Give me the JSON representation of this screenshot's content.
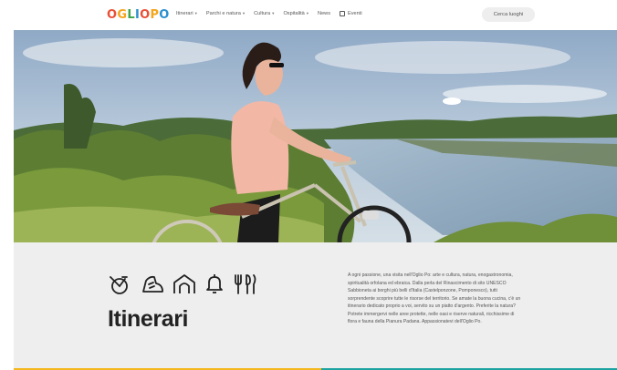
{
  "header": {
    "logo_letters": [
      {
        "ch": "O",
        "color": "#e94f35"
      },
      {
        "ch": "G",
        "color": "#f4a51c"
      },
      {
        "ch": "L",
        "color": "#3fa34d"
      },
      {
        "ch": "I",
        "color": "#2b8fcf"
      },
      {
        "ch": "O",
        "color": "#e94f35"
      },
      {
        "ch": "P",
        "color": "#f4a51c"
      },
      {
        "ch": "O",
        "color": "#2b8fcf"
      }
    ],
    "nav": {
      "itinerari": "Itinerari",
      "parchi": "Parchi e natura",
      "cultura": "Cultura",
      "ospitalita": "Ospitalità",
      "news": "News",
      "eventi": "Eventi"
    },
    "search_label": "Cerca luoghi"
  },
  "hero": {
    "alt": "Donna con bicicletta lungo il fiume Oglio"
  },
  "intro": {
    "title": "Itinerari",
    "icons": [
      "bicycle-icon",
      "hiking-boot-icon",
      "house-arch-icon",
      "bell-icon",
      "cutlery-icon"
    ],
    "text": "A ogni passione, una visita nell'Oglio Po: arte e cultura, natura, enogastronomia, spiritualità orfolana ed ebraica. Dalla perla del Rinascimento di sito UNESCO Sabbioneta ai borghi più belli d'Italia (Castelponzone, Pomponesco), tutti sorprendente scoprire tutte le risorse del territorio. Se amate la buona cucina, c'è un itinerario dedicato proprio a voi, servito su un piatto d'argento. Preferite la natura? Potrete immergervi nelle aree protette, nelle oasi e riserve naturali, ricchissime di flora e fauna della Pianura Padana. Appassionatevi dell'Oglio Po."
  },
  "colors": {
    "bar_yellow": "#f4b71c",
    "bar_teal": "#1aa3a0"
  }
}
